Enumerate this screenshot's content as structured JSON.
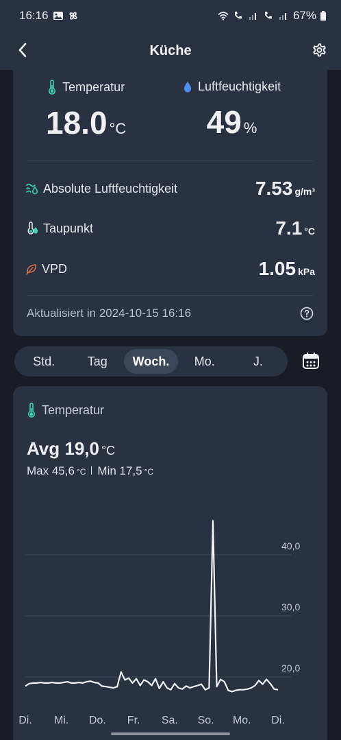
{
  "status": {
    "time": "16:16",
    "battery": "67%"
  },
  "header": {
    "title": "Küche"
  },
  "metrics": {
    "temperature": {
      "label": "Temperatur",
      "value": "18.0",
      "unit": "°C"
    },
    "humidity": {
      "label": "Luftfeuchtigkeit",
      "value": "49",
      "unit": "%"
    }
  },
  "details": [
    {
      "label": "Absolute Luftfeuchtigkeit",
      "value": "7.53",
      "unit": "g/m³",
      "icon": "absolute-humidity-icon"
    },
    {
      "label": "Taupunkt",
      "value": "7.1",
      "unit": "°C",
      "icon": "dew-point-icon"
    },
    {
      "label": "VPD",
      "value": "1.05",
      "unit": "kPa",
      "icon": "leaf-icon"
    }
  ],
  "updated": "Aktualisiert in 2024-10-15 16:16",
  "tabs": [
    "Std.",
    "Tag",
    "Woch.",
    "Mo.",
    "J."
  ],
  "active_tab": "Woch.",
  "chart_card": {
    "title": "Temperatur",
    "avg_label": "Avg 19,0",
    "avg_unit": "°C",
    "max_label": "Max 45,6",
    "min_label": "Min 17,5",
    "unit": "°C"
  },
  "colors": {
    "accent_teal": "#3fd6b0",
    "humidity_blue": "#4c8ff0",
    "leaf_orange": "#e0744a",
    "card_bg": "#283241"
  },
  "chart_data": {
    "type": "line",
    "xlabel": "",
    "ylabel": "",
    "x_ticks": [
      "Di.",
      "Mi.",
      "Do.",
      "Fr.",
      "Sa.",
      "So.",
      "Mo.",
      "Di."
    ],
    "y_ticks": [
      "20,0",
      "30,0",
      "40,0"
    ],
    "ylim": [
      16,
      48
    ],
    "grid": true,
    "series": [
      {
        "values": [
          18.5,
          18.9,
          19.0,
          19.0,
          19.1,
          19.0,
          19.0,
          19.1,
          19.0,
          19.0,
          19.1,
          19.2,
          19.0,
          19.0,
          19.1,
          19.0,
          19.2,
          19.3,
          19.1,
          19.0,
          18.5,
          18.4,
          18.3,
          18.2,
          18.4,
          20.8,
          19.5,
          19.8,
          19.0,
          19.7,
          18.6,
          19.5,
          19.2,
          18.6,
          19.7,
          18.1,
          19.2,
          18.2,
          17.9,
          18.9,
          18.2,
          18.0,
          18.5,
          18.2,
          18.4,
          18.6,
          18.8,
          17.9,
          18.2,
          45.6,
          18.4,
          19.6,
          19.2,
          17.8,
          17.6,
          17.8,
          17.9,
          17.9,
          18.0,
          18.2,
          18.6,
          19.4,
          18.8,
          19.6,
          18.9,
          18.0,
          17.9
        ]
      }
    ]
  }
}
